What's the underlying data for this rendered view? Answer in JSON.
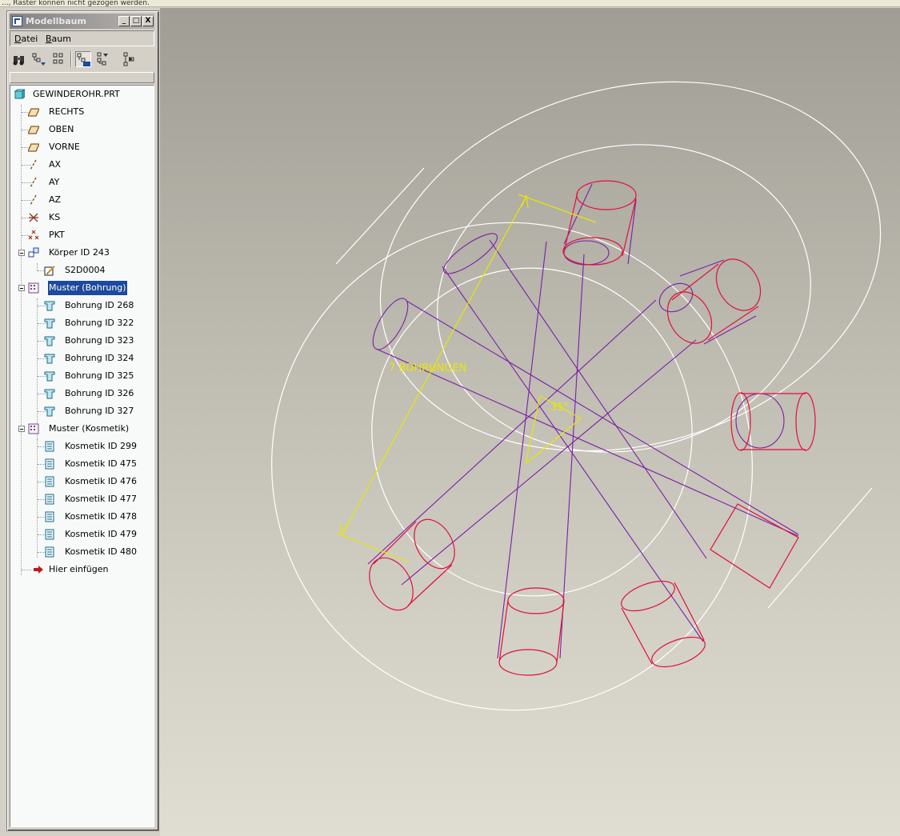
{
  "status_bar": {
    "text": "..., Raster können nicht gezogen werden."
  },
  "window": {
    "title": "Modellbaum",
    "buttons": {
      "minimize": "_",
      "maximize": "□",
      "close": "X"
    }
  },
  "menu": {
    "datei": {
      "accel": "D",
      "rest": "atei"
    },
    "baum": {
      "accel": "B",
      "rest": "aum"
    }
  },
  "toolbar": {
    "tools": [
      "show-icon",
      "settings-filter-icon",
      "tree-columns-icon",
      "layer-tree-icon",
      "expand-all-icon",
      "insert-icon"
    ]
  },
  "tree": {
    "root": "GEWINDEROHR.PRT",
    "datums": [
      {
        "label": "RECHTS",
        "icon": "datum-plane-icon"
      },
      {
        "label": "OBEN",
        "icon": "datum-plane-icon"
      },
      {
        "label": "VORNE",
        "icon": "datum-plane-icon"
      },
      {
        "label": "AX",
        "icon": "datum-axis-icon"
      },
      {
        "label": "AY",
        "icon": "datum-axis-icon"
      },
      {
        "label": "AZ",
        "icon": "datum-axis-icon"
      },
      {
        "label": "KS",
        "icon": "coordinate-system-icon"
      },
      {
        "label": "PKT",
        "icon": "datum-point-icon"
      }
    ],
    "body": {
      "label": "Körper ID 243",
      "child": "S2D0004"
    },
    "pattern_holes": {
      "label": "Muster (Bohrung)",
      "selected": true,
      "items": [
        "Bohrung ID 268",
        "Bohrung ID 322",
        "Bohrung ID 323",
        "Bohrung ID 324",
        "Bohrung ID 325",
        "Bohrung ID 326",
        "Bohrung ID 327"
      ]
    },
    "pattern_cosmetic": {
      "label": "Muster (Kosmetik)",
      "items": [
        "Kosmetik ID 299",
        "Kosmetik ID 475",
        "Kosmetik ID 476",
        "Kosmetik ID 477",
        "Kosmetik ID 478",
        "Kosmetik ID 479",
        "Kosmetik ID 480"
      ]
    },
    "insert_here": "Hier einfügen"
  },
  "viewport": {
    "dimension_count_label": "7 BOHRUNGEN",
    "dimension_angle_label": "35°",
    "colors": {
      "outline": "#ffffff",
      "hole_axis": "#7a1fa8",
      "hole_edge": "#e0103c",
      "dimension": "#e8e800",
      "selection": "#1c4a9c"
    }
  }
}
